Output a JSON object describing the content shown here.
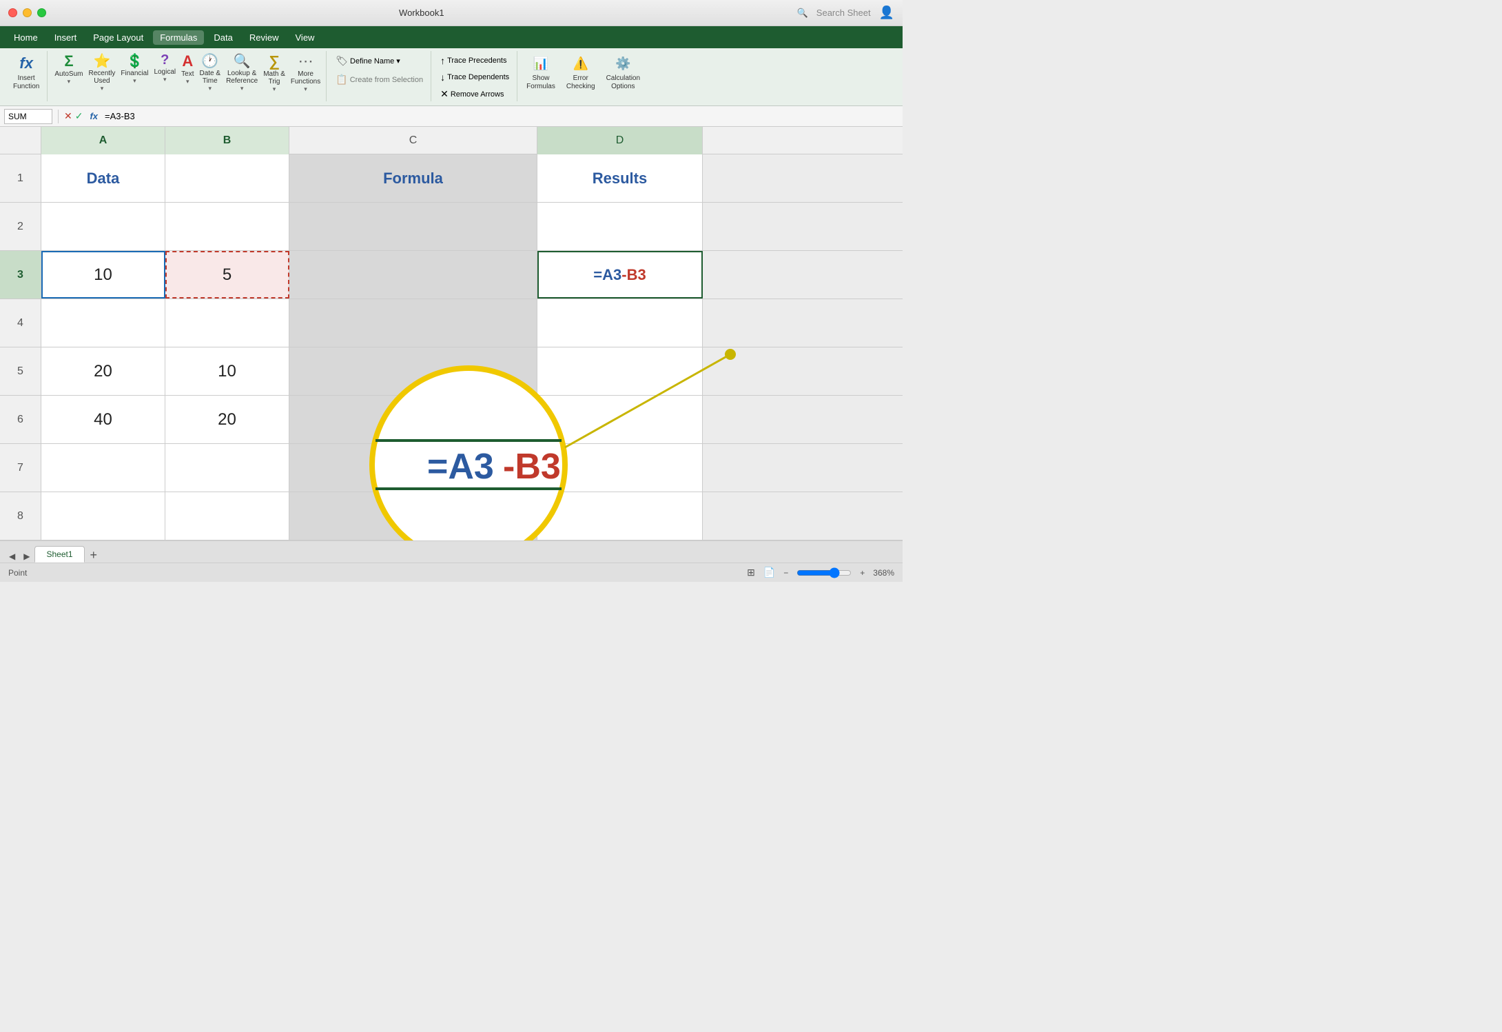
{
  "titleBar": {
    "title": "Workbook1",
    "searchPlaceholder": "Search Sheet"
  },
  "menuBar": {
    "items": [
      "Home",
      "Insert",
      "Page Layout",
      "Formulas",
      "Data",
      "Review",
      "View"
    ],
    "activeItem": "Formulas"
  },
  "ribbon": {
    "groups": [
      {
        "id": "insert-function",
        "items": [
          {
            "id": "insert-fn",
            "icon": "fx",
            "label": "Insert\nFunction",
            "iconColor": "#2563a8"
          }
        ]
      },
      {
        "id": "function-library",
        "items": [
          {
            "id": "autosum",
            "icon": "Σ",
            "label": "AutoSum",
            "iconColor": "#1e8c3a"
          },
          {
            "id": "recently-used",
            "icon": "⭐",
            "label": "Recently\nUsed",
            "iconColor": "#2563a8"
          },
          {
            "id": "financial",
            "icon": "💲",
            "label": "Financial",
            "iconColor": "#1e8c3a"
          },
          {
            "id": "logical",
            "icon": "?",
            "label": "Logical",
            "iconColor": "#7b3fb5"
          },
          {
            "id": "text",
            "icon": "A",
            "label": "Text",
            "iconColor": "#d43030"
          },
          {
            "id": "date-time",
            "icon": "🕐",
            "label": "Date &\nTime",
            "iconColor": "#c8621a"
          },
          {
            "id": "lookup-ref",
            "icon": "🔍",
            "label": "Lookup &\nReference",
            "iconColor": "#1a8a88"
          },
          {
            "id": "math-trig",
            "icon": "∑",
            "label": "Math &\nTrig",
            "iconColor": "#b8960a"
          },
          {
            "id": "more-fn",
            "icon": "···",
            "label": "More\nFunctions",
            "iconColor": "#666"
          }
        ]
      },
      {
        "id": "defined-names",
        "items": [
          {
            "id": "define-name",
            "label": "Define Name ▾",
            "small": true
          },
          {
            "id": "create-from-selection",
            "label": "Create from Selection",
            "small": true,
            "disabled": true
          }
        ]
      },
      {
        "id": "formula-auditing",
        "items": [
          {
            "id": "trace-precedents",
            "label": "Trace Precedents"
          },
          {
            "id": "trace-dependents",
            "label": "Trace Dependents"
          },
          {
            "id": "remove-arrows",
            "label": "Remove Arrows"
          }
        ]
      },
      {
        "id": "calculation",
        "items": [
          {
            "id": "show-formulas",
            "label": "Show\nFormulas"
          },
          {
            "id": "error-checking",
            "label": "Error\nChecking"
          },
          {
            "id": "calculation-options",
            "label": "Calculation\nOptions"
          }
        ]
      }
    ]
  },
  "formulaBar": {
    "nameBox": "SUM",
    "formula": "=A3-B3"
  },
  "columns": [
    "A",
    "B",
    "C",
    "D"
  ],
  "rows": [
    1,
    2,
    3,
    4,
    5,
    6,
    7,
    8
  ],
  "cells": {
    "A1": {
      "value": "Data",
      "style": "header"
    },
    "B1": {
      "value": "",
      "style": "normal"
    },
    "C1": {
      "value": "Formula",
      "style": "header"
    },
    "D1": {
      "value": "Results",
      "style": "header"
    },
    "A3": {
      "value": "10",
      "style": "normal",
      "selected": true
    },
    "B3": {
      "value": "5",
      "style": "normal",
      "copySource": true
    },
    "A5": {
      "value": "20",
      "style": "normal"
    },
    "B5": {
      "value": "10",
      "style": "normal"
    },
    "A6": {
      "value": "40",
      "style": "normal"
    },
    "B6": {
      "value": "20",
      "style": "normal"
    },
    "D3": {
      "value": "=A3-B3",
      "style": "formula-active"
    }
  },
  "formulaCircle": {
    "text": "=A3-B3",
    "partA": "=A3",
    "partB": "-B3"
  },
  "sheetTabs": {
    "tabs": [
      "Sheet1"
    ],
    "activeTab": "Sheet1"
  },
  "statusBar": {
    "mode": "Point",
    "zoom": "368%"
  }
}
